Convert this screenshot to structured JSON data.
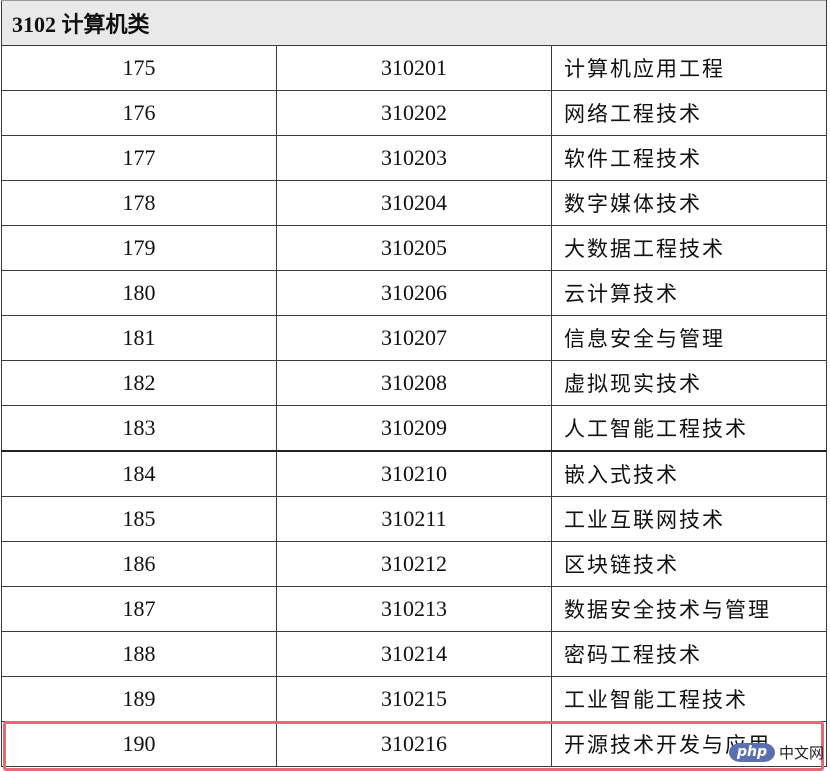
{
  "category": "3102 计算机类",
  "rows": [
    {
      "seq": "175",
      "code": "310201",
      "name": "计算机应用工程"
    },
    {
      "seq": "176",
      "code": "310202",
      "name": "网络工程技术"
    },
    {
      "seq": "177",
      "code": "310203",
      "name": "软件工程技术"
    },
    {
      "seq": "178",
      "code": "310204",
      "name": "数字媒体技术"
    },
    {
      "seq": "179",
      "code": "310205",
      "name": "大数据工程技术"
    },
    {
      "seq": "180",
      "code": "310206",
      "name": "云计算技术"
    },
    {
      "seq": "181",
      "code": "310207",
      "name": "信息安全与管理"
    },
    {
      "seq": "182",
      "code": "310208",
      "name": "虚拟现实技术"
    },
    {
      "seq": "183",
      "code": "310209",
      "name": "人工智能工程技术"
    },
    {
      "seq": "184",
      "code": "310210",
      "name": "嵌入式技术"
    },
    {
      "seq": "185",
      "code": "310211",
      "name": "工业互联网技术"
    },
    {
      "seq": "186",
      "code": "310212",
      "name": "区块链技术"
    },
    {
      "seq": "187",
      "code": "310213",
      "name": "数据安全技术与管理"
    },
    {
      "seq": "188",
      "code": "310214",
      "name": "密码工程技术"
    },
    {
      "seq": "189",
      "code": "310215",
      "name": "工业智能工程技术"
    },
    {
      "seq": "190",
      "code": "310216",
      "name": "开源技术开发与应用"
    }
  ],
  "highlighted_row": "190",
  "watermark": {
    "logo": "php",
    "text": "中文网"
  }
}
